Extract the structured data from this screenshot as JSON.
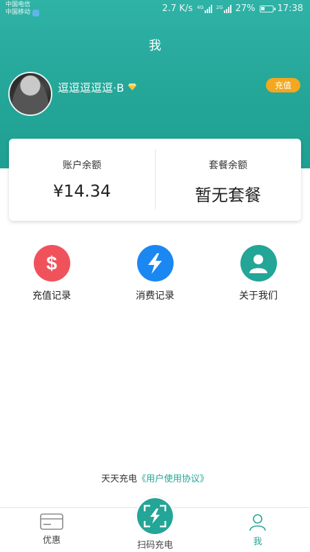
{
  "status_bar": {
    "carrier1": "中国电信",
    "carrier2": "中国移动",
    "speed": "2.7 K/s",
    "net1": "4G",
    "net2": "2G",
    "battery": "27%",
    "time": "17:38"
  },
  "header": {
    "title": "我"
  },
  "profile": {
    "username": "逗逗逗逗逗·B",
    "recharge_label": "充值"
  },
  "balance": {
    "account_label": "账户余额",
    "account_value": "¥14.34",
    "package_label": "套餐余额",
    "package_value": "暂无套餐"
  },
  "actions": [
    {
      "label": "充值记录",
      "icon": "dollar-icon",
      "color": "#f0525c"
    },
    {
      "label": "消费记录",
      "icon": "lightning-icon",
      "color": "#1b87f2"
    },
    {
      "label": "关于我们",
      "icon": "user-icon",
      "color": "#23a597"
    }
  ],
  "agreement": {
    "prefix": "天天充电",
    "link": "《用户使用协议》"
  },
  "nav": {
    "discount": "优惠",
    "scan": "扫码充电",
    "me": "我"
  },
  "colors": {
    "accent": "#23a597",
    "recharge": "#f3a81f"
  }
}
